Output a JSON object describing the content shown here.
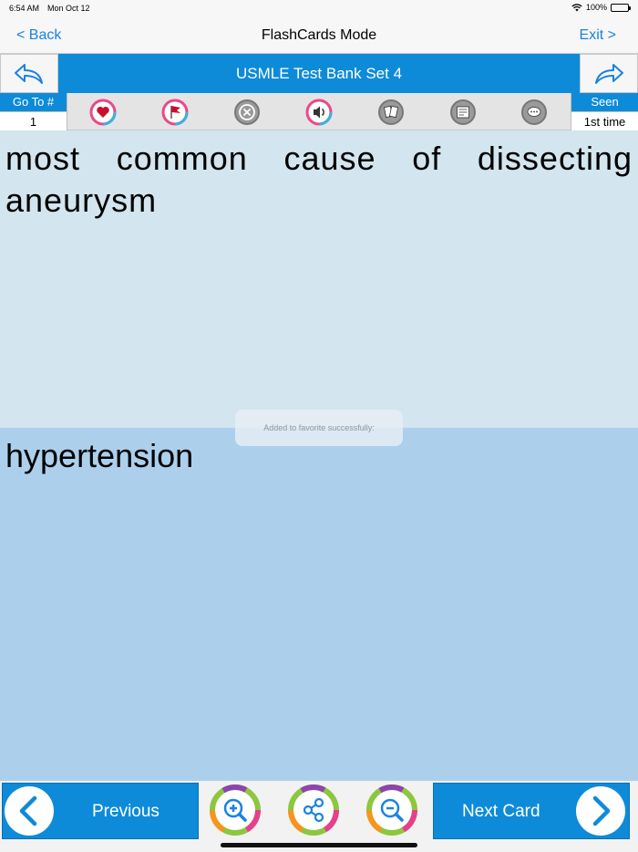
{
  "status": {
    "time": "6:54 AM",
    "date": "Mon Oct 12",
    "battery": "100%"
  },
  "nav": {
    "back": "< Back",
    "title": "FlashCards Mode",
    "exit": "Exit >"
  },
  "header": {
    "set_title": "USMLE Test Bank Set 4"
  },
  "toolbar": {
    "goto_label": "Go To #",
    "goto_value": "1",
    "seen_label": "Seen",
    "seen_value": "1st time",
    "tools": [
      "favorite-icon",
      "flag-icon",
      "remove-icon",
      "speaker-icon",
      "cards-icon",
      "notes-icon",
      "comment-icon"
    ]
  },
  "card": {
    "question": "most common cause of dissecting aneurysm",
    "answer": "hypertension"
  },
  "toast": "Added to favorite successfully:",
  "bottom": {
    "previous": "Previous",
    "next": "Next Card"
  },
  "colors": {
    "accent": "#0e8bd8",
    "question_bg": "#d3e5ee",
    "answer_bg": "#acd0ec",
    "link": "#1a82e2"
  }
}
